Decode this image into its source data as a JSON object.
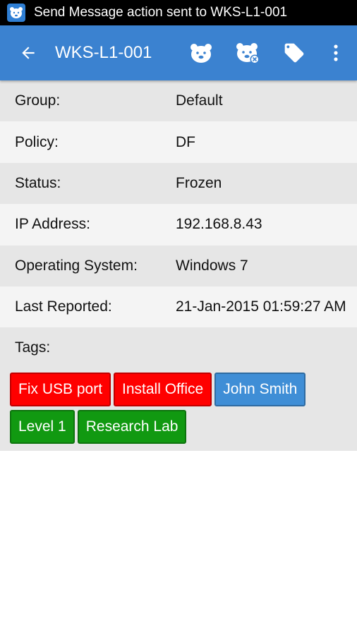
{
  "status_bar": {
    "notification_text": "Send Message action sent to WKS-L1-001"
  },
  "app_bar": {
    "title": "WKS-L1-001",
    "icons": [
      "arrow-back-icon",
      "bear-freeze-icon",
      "bear-thaw-icon",
      "tag-icon",
      "more-vertical-icon"
    ]
  },
  "details": [
    {
      "label": "Group:",
      "value": "Default"
    },
    {
      "label": "Policy:",
      "value": "DF"
    },
    {
      "label": "Status:",
      "value": "Frozen"
    },
    {
      "label": "IP Address:",
      "value": "192.168.8.43"
    },
    {
      "label": "Operating System:",
      "value": "Windows 7"
    },
    {
      "label": "Last Reported:",
      "value": "21-Jan-2015 01:59:27 AM"
    }
  ],
  "tags": {
    "label": "Tags:",
    "items": [
      {
        "text": "Fix USB port",
        "color": "#ff0000"
      },
      {
        "text": "Install Office",
        "color": "#ff0000"
      },
      {
        "text": "John Smith",
        "color": "#3f8ed6"
      },
      {
        "text": "Level 1",
        "color": "#119911"
      },
      {
        "text": "Research Lab",
        "color": "#119911"
      }
    ]
  },
  "colors": {
    "app_bar": "#3b82d0",
    "status_bar": "#000000",
    "row_dark": "#e6e6e6",
    "row_light": "#f4f4f4"
  }
}
